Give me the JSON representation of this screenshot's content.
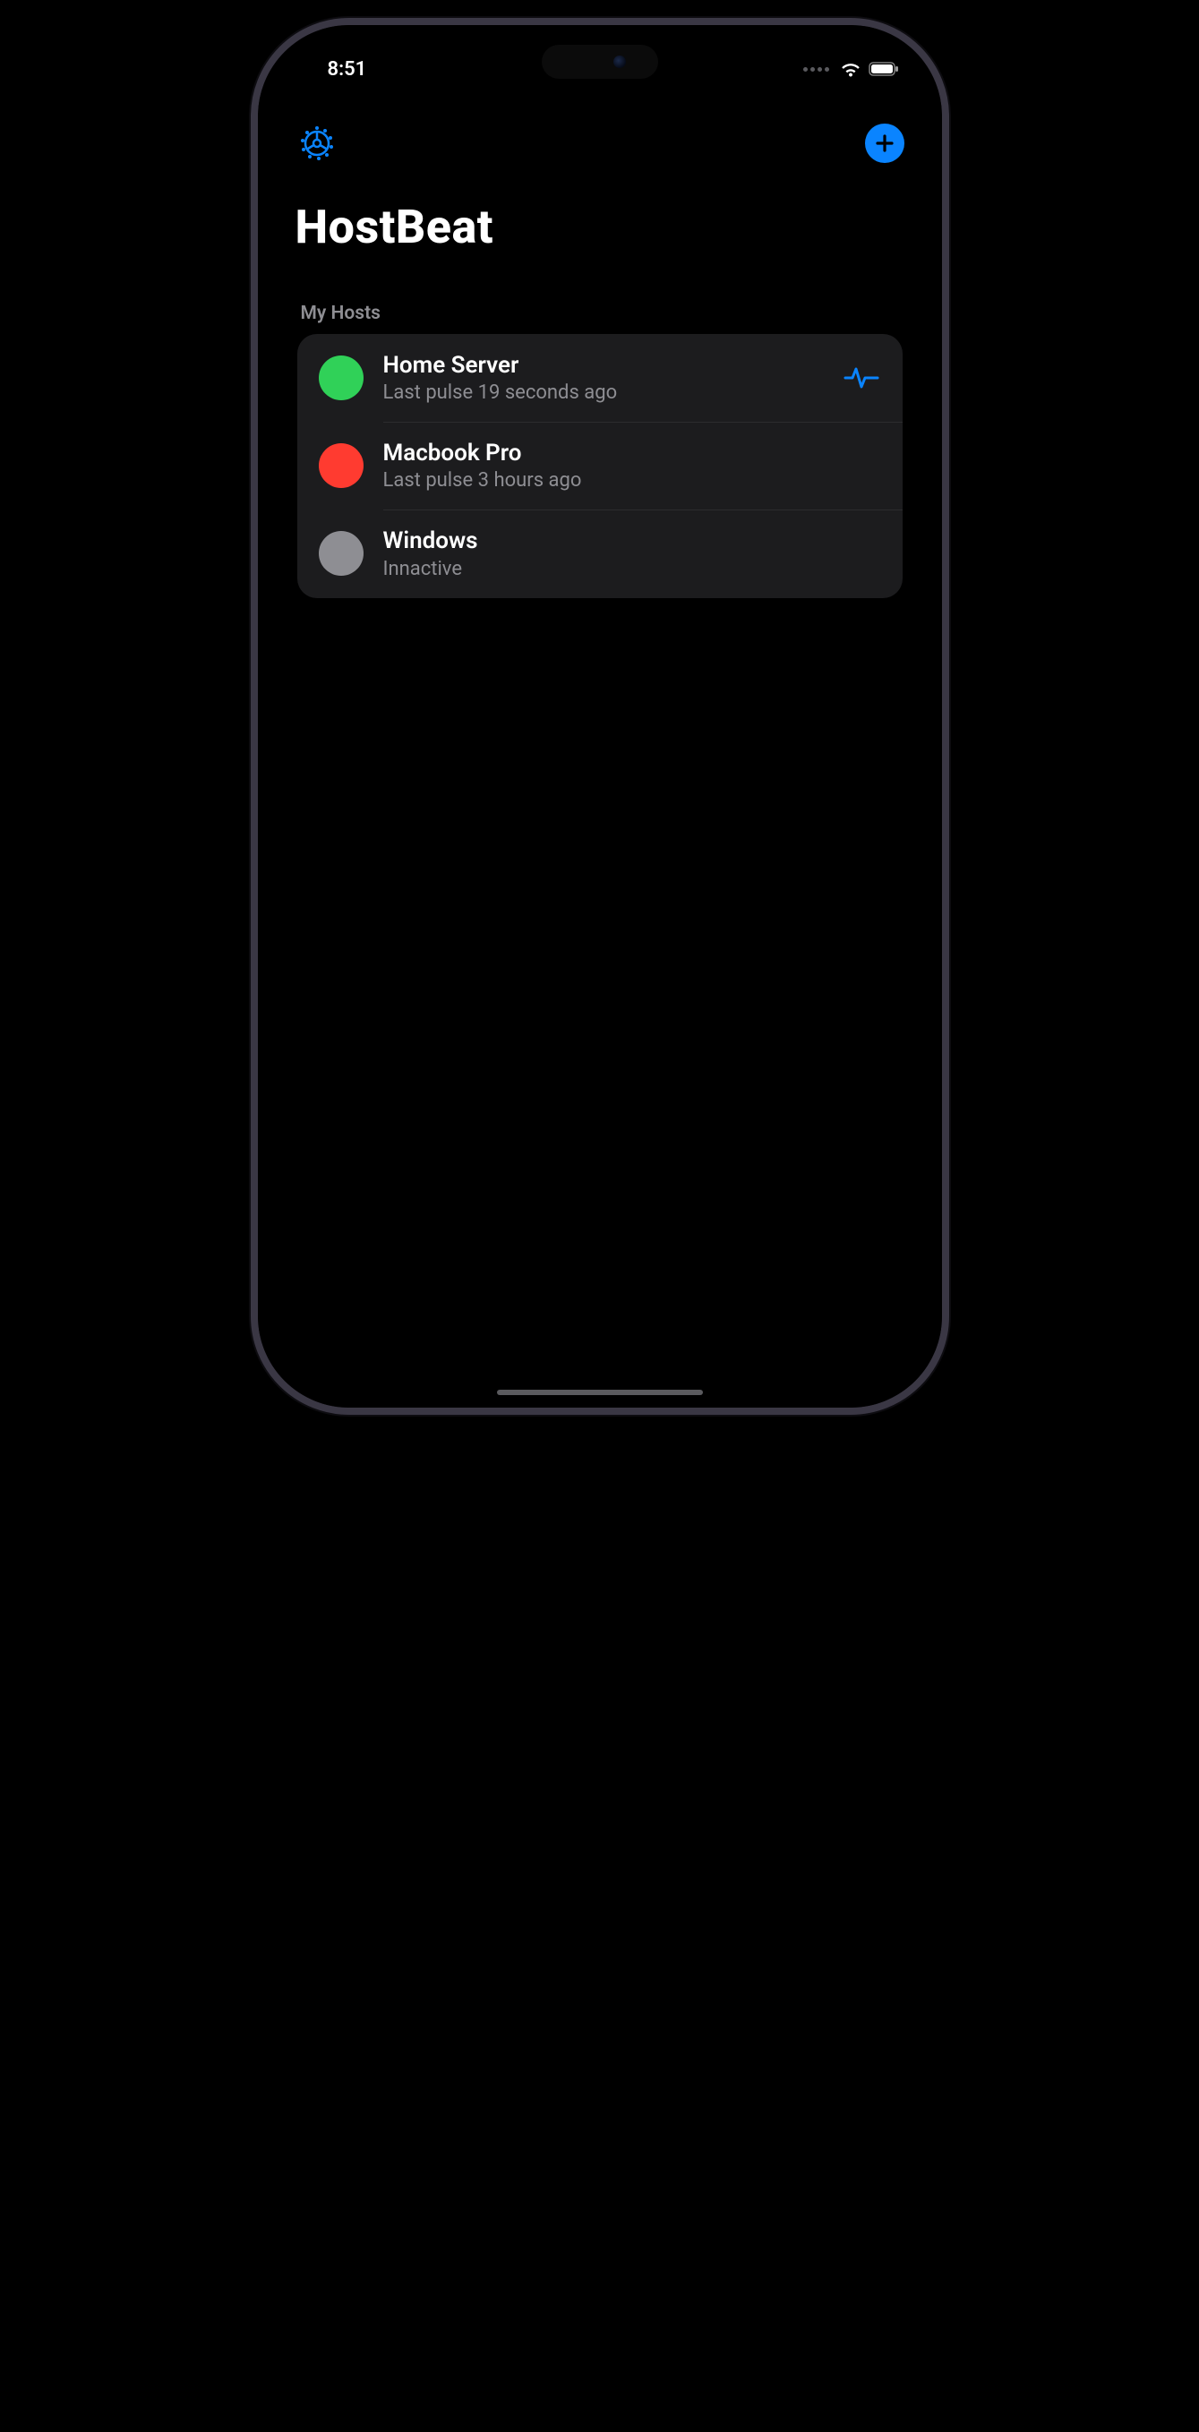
{
  "status_bar": {
    "time": "8:51"
  },
  "nav": {
    "settings_icon": "gear-icon",
    "add_icon": "plus-icon"
  },
  "header": {
    "title": "HostBeat"
  },
  "section": {
    "label": "My Hosts"
  },
  "colors": {
    "green": "#30d158",
    "red": "#ff3b30",
    "gray": "#8e8e93",
    "accent": "#0a84ff"
  },
  "hosts": [
    {
      "name": "Home Server",
      "subtitle": "Last pulse 19 seconds ago",
      "status": "green",
      "show_pulse": true
    },
    {
      "name": "Macbook Pro",
      "subtitle": "Last pulse 3 hours ago",
      "status": "red",
      "show_pulse": false
    },
    {
      "name": "Windows",
      "subtitle": "Innactive",
      "status": "gray",
      "show_pulse": false
    }
  ]
}
